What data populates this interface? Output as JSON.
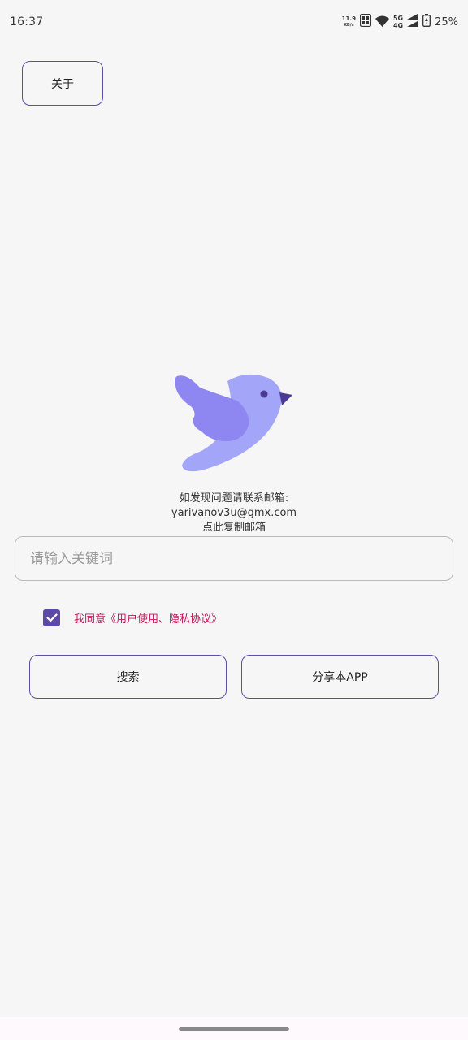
{
  "status_bar": {
    "time": "16:37",
    "net_speed_value": "11.9",
    "net_speed_unit": "KB/s",
    "net_5g": "5G",
    "net_4g": "4G",
    "battery": "25%"
  },
  "about_button": "关于",
  "contact": {
    "line1": "如发现问题请联系邮箱:",
    "email": "yarivanov3u@gmx.com",
    "copy_hint": "点此复制邮箱"
  },
  "search": {
    "placeholder": "请输入关键词",
    "value": ""
  },
  "agreement": {
    "checked": true,
    "label": "我同意《用户使用、隐私协议》"
  },
  "buttons": {
    "search": "搜索",
    "share": "分享本APP"
  },
  "colors": {
    "accent": "#5d4aa6",
    "agreement_text": "#c2185b",
    "logo_body": "#a3a6f8",
    "logo_wing": "#8f87f1"
  },
  "icons": [
    "net-speed-icon",
    "signal-hd-icon",
    "wifi-icon",
    "cell-signal-icon",
    "battery-icon",
    "bird-logo-icon",
    "check-icon"
  ]
}
